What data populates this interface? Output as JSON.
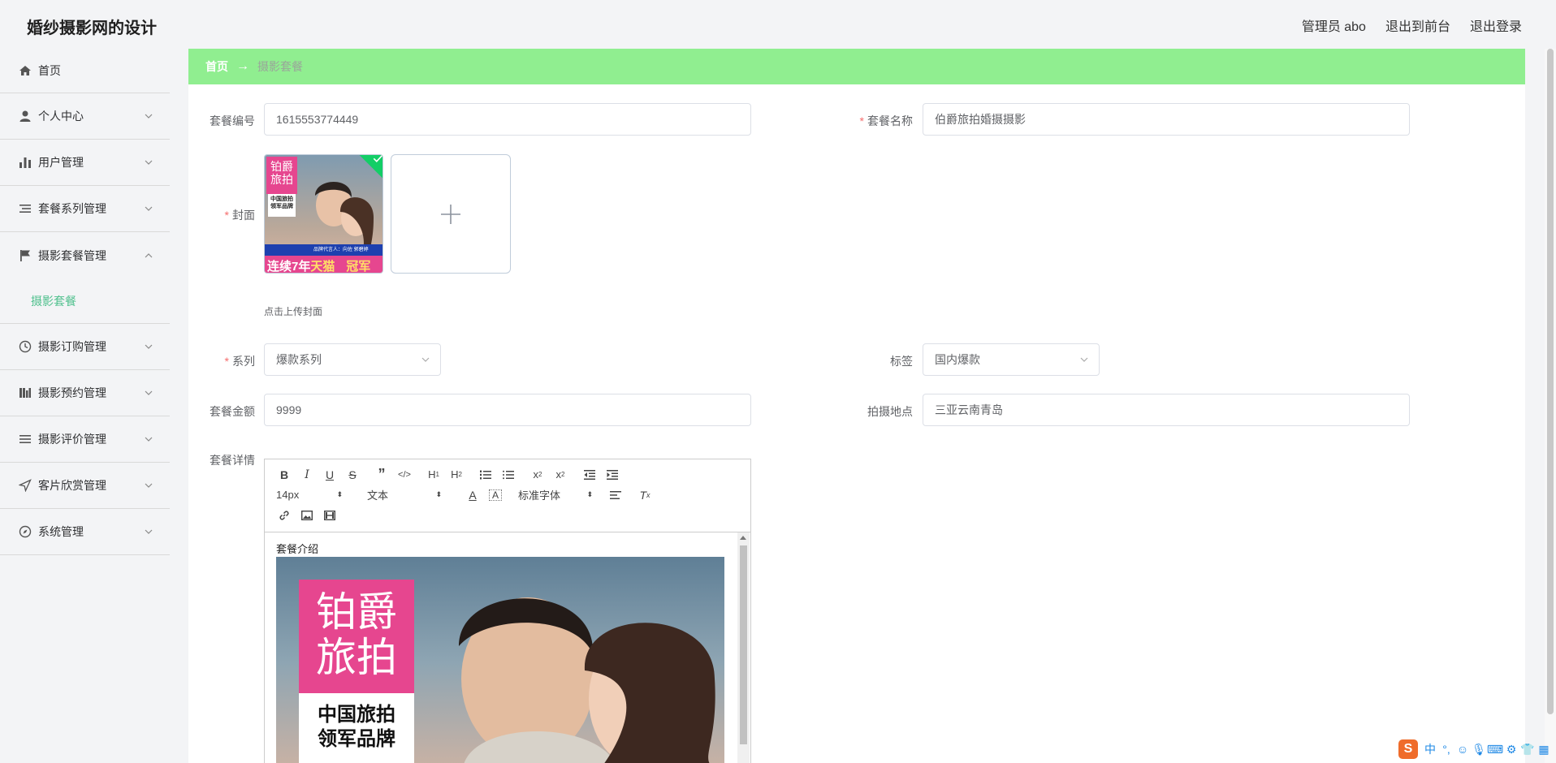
{
  "header": {
    "title": "婚纱摄影网的设计",
    "admin": "管理员 abo",
    "to_front": "退出到前台",
    "logout": "退出登录"
  },
  "sidebar": {
    "items": [
      {
        "label": "首页",
        "icon": "home-icon"
      },
      {
        "label": "个人中心",
        "icon": "user-icon"
      },
      {
        "label": "用户管理",
        "icon": "bar-chart-icon"
      },
      {
        "label": "套餐系列管理",
        "icon": "list-icon"
      },
      {
        "label": "摄影套餐管理",
        "icon": "flag-icon",
        "expanded": true
      },
      {
        "label": "摄影订购管理",
        "icon": "clock-icon"
      },
      {
        "label": "摄影预约管理",
        "icon": "columns-icon"
      },
      {
        "label": "摄影评价管理",
        "icon": "menu-icon"
      },
      {
        "label": "客片欣赏管理",
        "icon": "send-icon"
      },
      {
        "label": "系统管理",
        "icon": "compass-icon"
      }
    ],
    "sub_active": "摄影套餐",
    "active_color": "#4fc08d"
  },
  "breadcrumb": {
    "home": "首页",
    "sep": "→",
    "current": "摄影套餐",
    "bg_color": "#90ee90"
  },
  "form": {
    "code_label": "套餐编号",
    "code_value": "1615553774449",
    "name_label": "套餐名称",
    "name_value": "伯爵旅拍婚摄摄影",
    "cover_label": "封面",
    "cover_hint": "点击上传封面",
    "cover_image": {
      "brand_line1": "铂爵",
      "brand_line2": "旅拍",
      "tag1": "中国旅拍",
      "tag2": "领军品牌",
      "banner": "连续7年",
      "banner_highlight": "天猫",
      "banner_end": "冠军",
      "endorser": "品牌代言人：向佐 郭碧婷"
    },
    "series_label": "系列",
    "series_value": "爆款系列",
    "tag_label": "标签",
    "tag_value": "国内爆款",
    "price_label": "套餐金额",
    "price_value": "9999",
    "location_label": "拍摄地点",
    "location_value": "三亚云南青岛",
    "detail_label": "套餐详情"
  },
  "editor": {
    "font_size": "14px",
    "text_type": "文本",
    "font_family": "标准字体",
    "content_title": "套餐介绍",
    "img_brand1": "铂爵",
    "img_brand2": "旅拍",
    "img_tag1": "中国旅拍",
    "img_tag2": "领军品牌"
  },
  "tray": {
    "lang": "中"
  }
}
